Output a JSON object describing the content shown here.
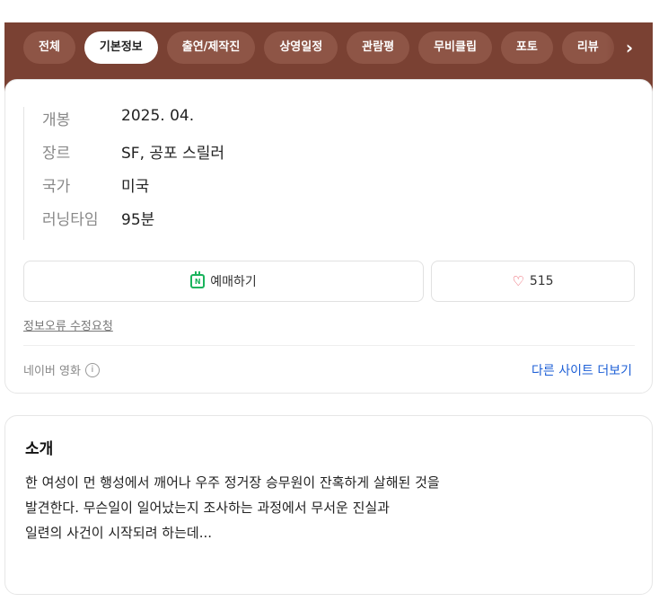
{
  "tabs": [
    {
      "label": "전체",
      "active": false
    },
    {
      "label": "기본정보",
      "active": true
    },
    {
      "label": "출연/제작진",
      "active": false
    },
    {
      "label": "상영일정",
      "active": false
    },
    {
      "label": "관람평",
      "active": false
    },
    {
      "label": "무비클립",
      "active": false
    },
    {
      "label": "포토",
      "active": false
    },
    {
      "label": "리뷰",
      "active": false
    }
  ],
  "tab_next_icon": "chevron-right-icon",
  "info": {
    "rows": [
      {
        "key": "개봉",
        "value": "2025. 04."
      },
      {
        "key": "장르",
        "value": "SF, 공포 스릴러"
      },
      {
        "key": "국가",
        "value": "미국"
      },
      {
        "key": "러닝타임",
        "value": "95분"
      }
    ]
  },
  "actions": {
    "book_label": "예매하기",
    "book_icon": "naver-calendar-icon",
    "like_count": "515",
    "like_icon": "heart-outline-icon",
    "accent_green": "#19b35c",
    "heart_color": "#e84856"
  },
  "report_link": "정보오류 수정요청",
  "source": {
    "label": "네이버 영화",
    "info_icon": "ⓘ"
  },
  "more_link": "다른 사이트 더보기",
  "intro": {
    "title": "소개",
    "lines": [
      "한 여성이 먼 행성에서 깨어나 우주 정거장 승무원이 잔혹하게 살해된 것을",
      "발견한다. 무슨일이 일어났는지 조사하는 과정에서 무서운 진실과",
      "일련의 사건이 시작되려 하는데..."
    ]
  },
  "theme": {
    "band_color": "#7a4133",
    "link_color": "#1d5fd6"
  }
}
